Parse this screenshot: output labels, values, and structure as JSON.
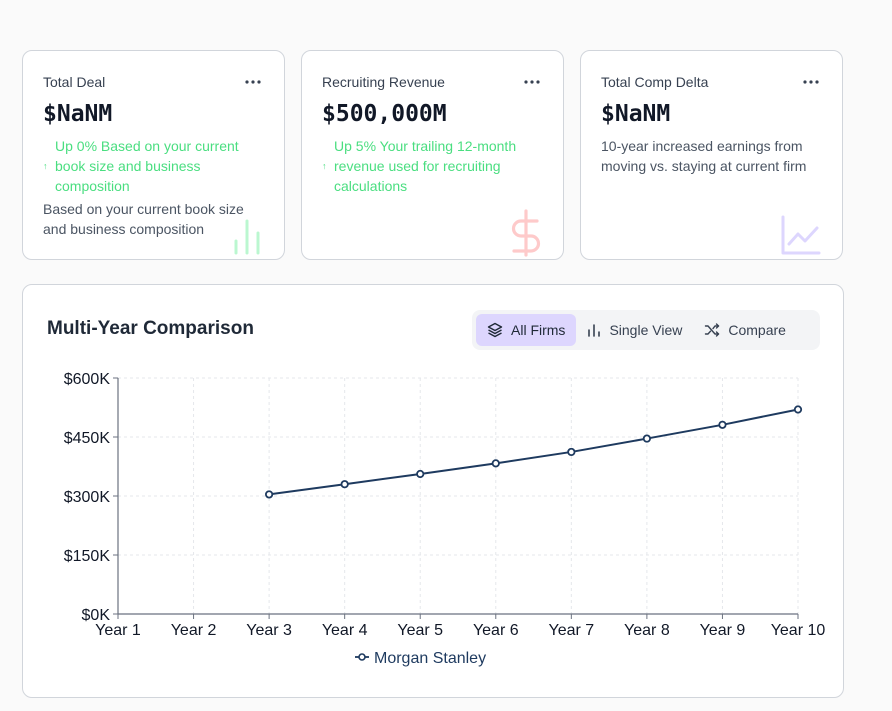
{
  "cards": [
    {
      "title": "Total Deal",
      "value": "$NaNM",
      "trend_arrow": "↑",
      "trend": "Up 0% Based on your current book size and business composition",
      "description": "Based on your current book size and business composition",
      "icon": "bar-chart-icon",
      "icon_color": "#bbf7d0"
    },
    {
      "title": "Recruiting Revenue",
      "value": "$500,000M",
      "trend_arrow": "↑",
      "trend": "Up 5% Your trailing 12-month revenue used for recruiting calculations",
      "icon": "dollar-icon",
      "icon_color": "#fecaca"
    },
    {
      "title": "Total Comp Delta",
      "value": "$NaNM",
      "description": "10-year increased earnings from moving vs. staying at current firm",
      "icon": "line-chart-icon",
      "icon_color": "#ddd6fe"
    }
  ],
  "panel": {
    "title": "Multi-Year Comparison",
    "toggles": [
      {
        "label": "All Firms",
        "icon": "layers-icon",
        "active": true
      },
      {
        "label": "Single View",
        "icon": "bar-chart-icon",
        "active": false
      },
      {
        "label": "Compare",
        "icon": "shuffle-icon",
        "active": false
      }
    ]
  },
  "colors": {
    "trend_green": "#4ade80",
    "active_toggle": "#ddd6fe",
    "series": "#1e3a5f"
  },
  "chart_data": {
    "type": "line",
    "x": [
      "Year 1",
      "Year 2",
      "Year 3",
      "Year 4",
      "Year 5",
      "Year 6",
      "Year 7",
      "Year 8",
      "Year 9",
      "Year 10"
    ],
    "series": [
      {
        "name": "Morgan Stanley",
        "values": [
          null,
          null,
          304000,
          330000,
          356000,
          383000,
          412000,
          446000,
          481000,
          520000
        ]
      }
    ],
    "yticks": [
      "$0K",
      "$150K",
      "$300K",
      "$450K",
      "$600K"
    ],
    "ylim": [
      0,
      600000
    ],
    "grid": true,
    "legend": "bottom-center"
  }
}
